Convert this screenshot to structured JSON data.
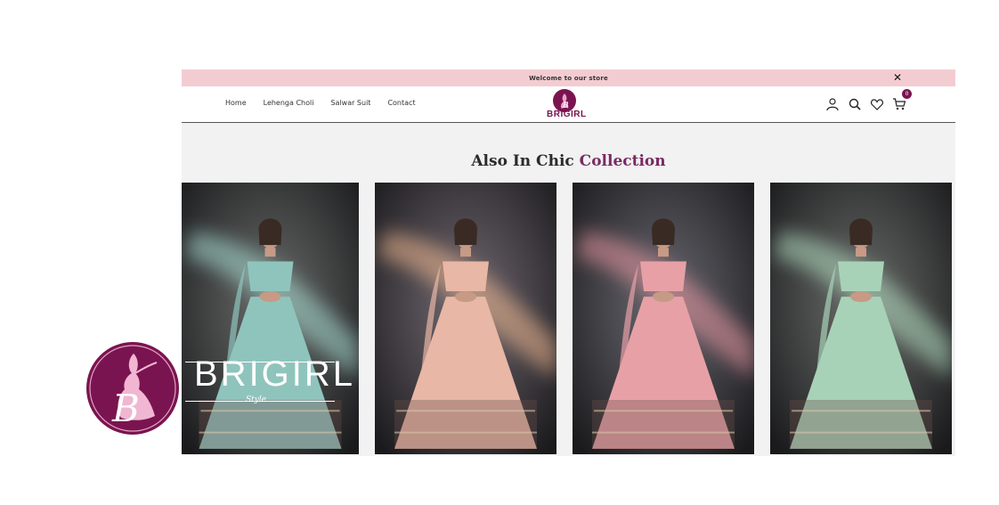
{
  "announcement": {
    "text": "Welcome to our store",
    "close_icon": "close-icon"
  },
  "nav": {
    "items": [
      "Home",
      "Lehenga Choli",
      "Salwar Suit",
      "Contact"
    ]
  },
  "logo": {
    "text": "BRIGIRL",
    "sub": "Style"
  },
  "header_icons": {
    "account": "user-icon",
    "search": "search-icon",
    "wishlist": "heart-icon",
    "cart": "cart-icon",
    "cart_count": "0"
  },
  "section": {
    "title_main": "Also In Chic",
    "title_accent": "Collection"
  },
  "products": [
    {
      "name": "product-1",
      "dress": "#8fc4bd",
      "light": "#a8ddd2",
      "bg": "#2e3230"
    },
    {
      "name": "product-2",
      "dress": "#e8b7a6",
      "light": "#f0b890",
      "bg": "#3a2e3a"
    },
    {
      "name": "product-3",
      "dress": "#e7a1a6",
      "light": "#e896a2",
      "bg": "#2f2d38"
    },
    {
      "name": "product-4",
      "dress": "#a8d2b8",
      "light": "#b4dfc2",
      "bg": "#2f3230"
    }
  ],
  "brand_overlay": {
    "word": "BRIGIRL",
    "sub": "Style"
  },
  "colors": {
    "accent": "#7a1450",
    "announce_bg": "#f3ccd2",
    "section_bg": "#f1f2f1"
  }
}
